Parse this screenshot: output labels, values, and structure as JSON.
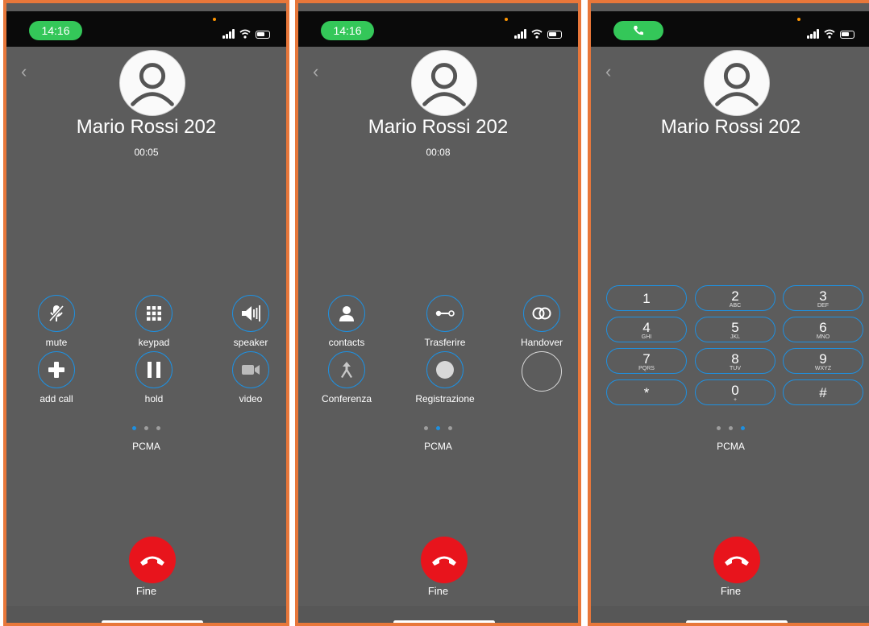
{
  "screens": [
    {
      "status": {
        "time": "14:16"
      },
      "caller": "Mario Rossi 202",
      "timer": "00:05",
      "buttons": [
        {
          "label": "mute",
          "icon": "mic-off-icon"
        },
        {
          "label": "keypad",
          "icon": "keypad-grid-icon"
        },
        {
          "label": "speaker",
          "icon": "speaker-icon"
        },
        {
          "label": "add call",
          "icon": "plus-icon"
        },
        {
          "label": "hold",
          "icon": "pause-icon"
        },
        {
          "label": "video",
          "icon": "video-camera-icon"
        }
      ],
      "page_index": 0,
      "codec": "PCMA",
      "end_label": "Fine"
    },
    {
      "status": {
        "time": "14:16"
      },
      "caller": "Mario Rossi 202",
      "timer": "00:08",
      "buttons": [
        {
          "label": "contacts",
          "icon": "contact-person-icon"
        },
        {
          "label": "Trasferire",
          "icon": "transfer-icon"
        },
        {
          "label": "Handover",
          "icon": "handover-rings-icon"
        },
        {
          "label": "Conferenza",
          "icon": "merge-arrows-icon"
        },
        {
          "label": "Registrazione",
          "icon": "record-dot-icon"
        },
        {
          "label": "",
          "icon": "empty-circle"
        }
      ],
      "page_index": 1,
      "codec": "PCMA",
      "end_label": "Fine"
    },
    {
      "status": {
        "time": "",
        "call_indicator": "phone-icon"
      },
      "caller": "Mario Rossi 202",
      "keypad": [
        {
          "digit": "1",
          "letters": ""
        },
        {
          "digit": "2",
          "letters": "ABC"
        },
        {
          "digit": "3",
          "letters": "DEF"
        },
        {
          "digit": "4",
          "letters": "GHI"
        },
        {
          "digit": "5",
          "letters": "JKL"
        },
        {
          "digit": "6",
          "letters": "MNO"
        },
        {
          "digit": "7",
          "letters": "PQRS"
        },
        {
          "digit": "8",
          "letters": "TUV"
        },
        {
          "digit": "9",
          "letters": "WXYZ"
        },
        {
          "digit": "*",
          "letters": ""
        },
        {
          "digit": "0",
          "letters": "+"
        },
        {
          "digit": "#",
          "letters": ""
        }
      ],
      "page_index": 2,
      "codec": "PCMA",
      "end_label": "Fine"
    }
  ],
  "colors": {
    "accent": "#1e90e0",
    "end_call": "#e8141c",
    "frame": "#e8773a",
    "background": "#5c5c5c",
    "status_pill": "#34c759"
  }
}
